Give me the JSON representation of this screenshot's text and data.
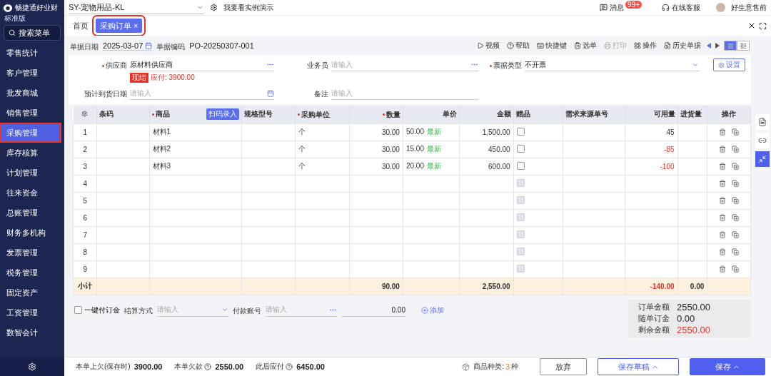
{
  "app": {
    "name": "畅捷通好业财",
    "edition": "标准版",
    "search": "搜索菜单"
  },
  "sidebar": {
    "items": [
      {
        "label": "零售统计",
        "selected": false
      },
      {
        "label": "客户管理",
        "selected": false
      },
      {
        "label": "批发商城",
        "selected": false
      },
      {
        "label": "销售管理",
        "selected": false
      },
      {
        "label": "采购管理",
        "selected": true
      },
      {
        "label": "库存核算",
        "selected": false
      },
      {
        "label": "计划管理",
        "selected": false
      },
      {
        "label": "往来资金",
        "selected": false
      },
      {
        "label": "总账管理",
        "selected": false
      },
      {
        "label": "财务多机构",
        "selected": false
      },
      {
        "label": "发票管理",
        "selected": false
      },
      {
        "label": "税务管理",
        "selected": false
      },
      {
        "label": "固定资产",
        "selected": false
      },
      {
        "label": "工资管理",
        "selected": false
      },
      {
        "label": "数智会计",
        "selected": false
      }
    ]
  },
  "topbar": {
    "org": "SY-宠物用品-KL",
    "demo": "我要看实例演示",
    "messages": "消息",
    "badge": "99+",
    "service": "在线客服",
    "user": "好生意售前"
  },
  "tabs": [
    {
      "label": "首页",
      "selected": false,
      "closable": false
    },
    {
      "label": "采购订单",
      "selected": true,
      "closable": true
    }
  ],
  "tab_close": "×",
  "header": {
    "date_label": "单据日期",
    "date": "2025-03-07",
    "code_label": "单据编码",
    "code": "PO-20250307-001"
  },
  "toolbar": [
    {
      "label": "视频",
      "disabled": false
    },
    {
      "label": "帮助",
      "disabled": false
    },
    {
      "label": "快捷键",
      "disabled": false
    },
    {
      "label": "选单",
      "disabled": false
    },
    {
      "label": "打印",
      "disabled": true
    },
    {
      "label": "操作",
      "disabled": false
    },
    {
      "label": "历史单据",
      "disabled": false
    }
  ],
  "view_toggle": [
    {
      "kind": "list",
      "selected": true
    },
    {
      "kind": "card",
      "selected": false
    }
  ],
  "form": {
    "supplier": {
      "label": "供应商",
      "value": "原材料供应商",
      "tag": "现结",
      "payable": "应付: 3900.00"
    },
    "staff": {
      "label": "业务员",
      "placeholder": "请输入"
    },
    "invoice_type": {
      "label": "票据类型",
      "value": "不开票"
    },
    "settings": "设置",
    "arrival": {
      "label": "预计到货日期",
      "placeholder": "请输入"
    },
    "remark": {
      "label": "备注",
      "placeholder": "请输入"
    }
  },
  "table": {
    "columns": [
      {
        "label": "条码",
        "required": false
      },
      {
        "label": "商品",
        "required": true
      },
      {
        "label": "规格型号",
        "required": false
      },
      {
        "label": "采购单位",
        "required": true
      },
      {
        "label": "数量",
        "required": true
      },
      {
        "label": "单价",
        "required": false
      },
      {
        "label": "金额",
        "required": false
      },
      {
        "label": "赠品",
        "required": false
      },
      {
        "label": "需求来源单号",
        "required": false
      },
      {
        "label": "可用量",
        "required": false
      },
      {
        "label": "进货量",
        "required": false
      },
      {
        "label": "操作",
        "required": false
      }
    ],
    "scan": "扫码录入",
    "rows": [
      {
        "no": "1",
        "product": "材料1",
        "unit": "个",
        "qty": "30.00",
        "price": "50.00",
        "price_tag": "最新",
        "amount": "1,500.00",
        "gift": false,
        "gift_disabled": false,
        "available": "45",
        "shortage": false
      },
      {
        "no": "2",
        "product": "材料2",
        "unit": "个",
        "qty": "30.00",
        "price": "15.00",
        "price_tag": "最新",
        "amount": "450.00",
        "gift": false,
        "gift_disabled": false,
        "available": "-85",
        "shortage": true
      },
      {
        "no": "3",
        "product": "材料3",
        "unit": "个",
        "qty": "30.00",
        "price": "20.00",
        "price_tag": "最新",
        "amount": "600.00",
        "gift": false,
        "gift_disabled": false,
        "available": "-100",
        "shortage": true
      },
      {
        "no": "4",
        "gift": false,
        "gift_disabled": true
      },
      {
        "no": "5",
        "gift": false,
        "gift_disabled": true
      },
      {
        "no": "6",
        "gift": false,
        "gift_disabled": true
      },
      {
        "no": "7",
        "gift": false,
        "gift_disabled": true
      },
      {
        "no": "8",
        "gift": false,
        "gift_disabled": true
      },
      {
        "no": "9",
        "gift": false,
        "gift_disabled": true
      }
    ],
    "subtotal": {
      "label": "小计",
      "qty": "90.00",
      "amount": "2,550.00",
      "available": "-140.00",
      "incoming": "0.00"
    }
  },
  "payment": {
    "deposit": {
      "label": "一键付订金",
      "checked": false
    },
    "method": {
      "label": "结算方式",
      "placeholder": "请输入"
    },
    "account": {
      "label": "付款账号",
      "placeholder": "请输入"
    },
    "amount": "0.00",
    "add": "添加"
  },
  "summary": [
    {
      "label": "订单金额",
      "value": "2550.00",
      "alert": false
    },
    {
      "label": "随单订金",
      "value": "0.00",
      "alert": false
    },
    {
      "label": "剩余金额",
      "value": "2550.00",
      "alert": true
    }
  ],
  "footer": {
    "stats": [
      {
        "label": "本单上欠(保存时)",
        "value": "3900.00",
        "help": false
      },
      {
        "label": "本单欠款",
        "value": "2550.00",
        "help": true
      },
      {
        "label": "此后应付",
        "value": "6450.00",
        "help": true
      }
    ],
    "kinds_label": "商品种类:",
    "kinds": "3",
    "kinds_unit": "种",
    "buttons": [
      {
        "label": "放弃",
        "kind": "plain"
      },
      {
        "label": "保存草稿",
        "kind": "outline"
      },
      {
        "label": "保存",
        "kind": "primary"
      }
    ]
  }
}
